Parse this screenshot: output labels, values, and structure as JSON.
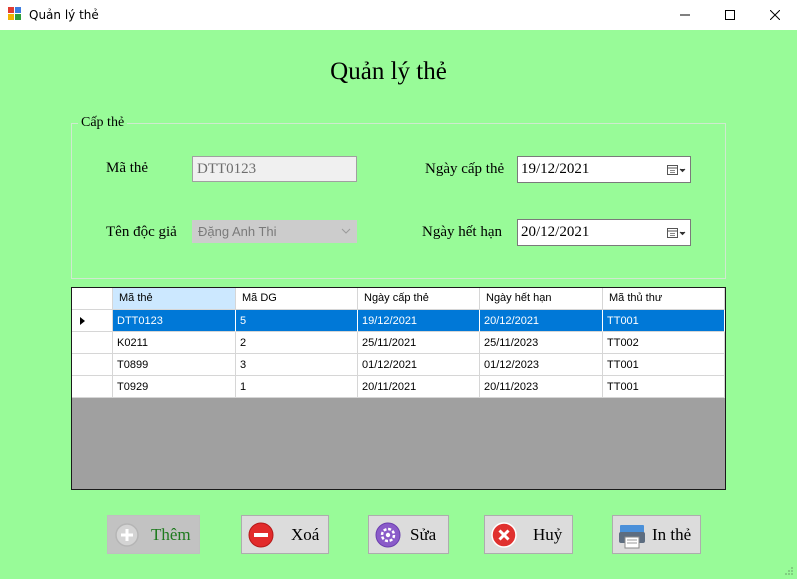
{
  "window": {
    "title": "Quản lý thẻ"
  },
  "form": {
    "heading": "Quản lý thẻ"
  },
  "group": {
    "legend": "Cấp thẻ",
    "ma_the_label": "Mã thẻ",
    "ma_the_value": "DTT0123",
    "ten_doc_gia_label": "Tên độc giả",
    "ten_doc_gia_value": "Đặng Anh Thi",
    "ngay_cap_label": "Ngày cấp thẻ",
    "ngay_cap_value": "19/12/2021",
    "ngay_het_han_label": "Ngày hết hạn",
    "ngay_het_han_value": "20/12/2021"
  },
  "grid": {
    "columns": [
      "Mã thẻ",
      "Mã DG",
      "Ngày cấp thẻ",
      "Ngày hết hạn",
      "Mã thủ thư"
    ],
    "rows": [
      [
        "DTT0123",
        "5",
        "19/12/2021",
        "20/12/2021",
        "TT001"
      ],
      [
        "K0211",
        "2",
        "25/11/2021",
        "25/11/2023",
        "TT002"
      ],
      [
        "T0899",
        "3",
        "01/12/2021",
        "01/12/2023",
        "TT001"
      ],
      [
        "T0929",
        "1",
        "20/11/2021",
        "20/11/2023",
        "TT001"
      ]
    ],
    "selected_row": 0
  },
  "buttons": {
    "them": "Thêm",
    "xoa": "Xoá",
    "sua": "Sửa",
    "huy": "Huỷ",
    "in_the": "In thẻ"
  },
  "colors": {
    "background": "#98fb98",
    "selection": "#0078d7",
    "grid_empty": "#a0a0a0"
  }
}
